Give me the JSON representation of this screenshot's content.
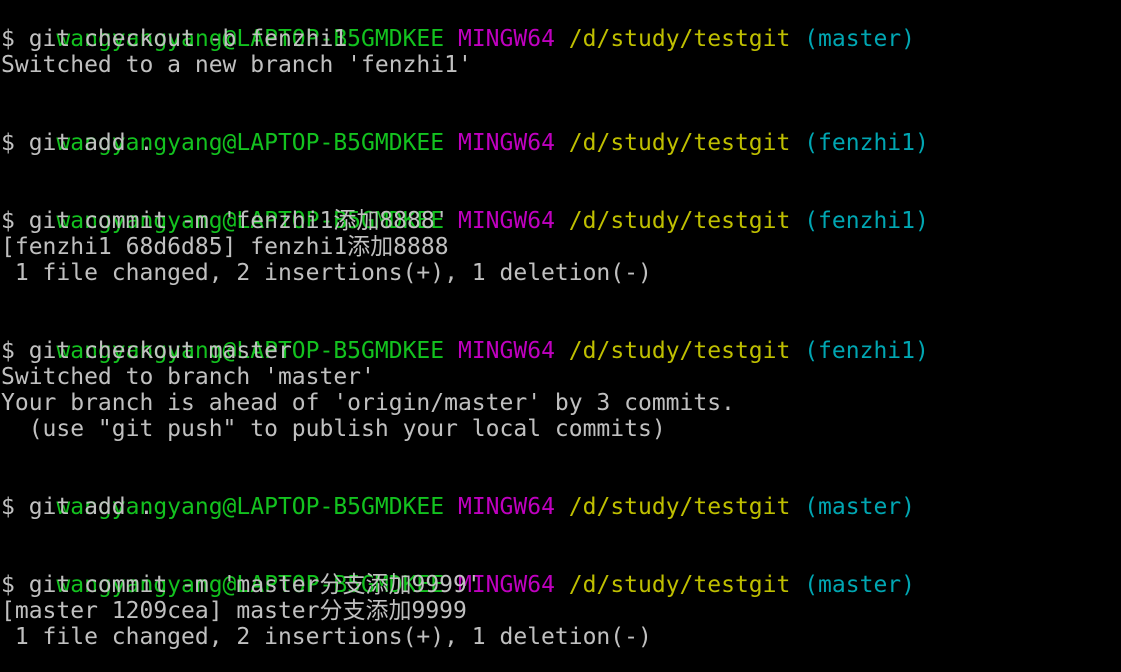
{
  "colors": {
    "background": "#000000",
    "text": "#c0c0c0",
    "user_host": "#13c21f",
    "shell": "#bf00bf",
    "path": "#bfbf00",
    "branch": "#00a6b2"
  },
  "blocks": [
    {
      "prompt": {
        "user": "wangyangyang@LAPTOP-B5GMDKEE",
        "shell": "MINGW64",
        "path": "/d/study/testgit",
        "branch": "(master)"
      },
      "command": "$ git checkout -b fenzhi1",
      "output": [
        "Switched to a new branch 'fenzhi1'"
      ]
    },
    {
      "prompt": {
        "user": "wangyangyang@LAPTOP-B5GMDKEE",
        "shell": "MINGW64",
        "path": "/d/study/testgit",
        "branch": "(fenzhi1)"
      },
      "command": "$ git add .",
      "output": []
    },
    {
      "prompt": {
        "user": "wangyangyang@LAPTOP-B5GMDKEE",
        "shell": "MINGW64",
        "path": "/d/study/testgit",
        "branch": "(fenzhi1)"
      },
      "command": "$ git commit -m 'fenzhi1添加8888'",
      "output": [
        "[fenzhi1 68d6d85] fenzhi1添加8888",
        " 1 file changed, 2 insertions(+), 1 deletion(-)"
      ]
    },
    {
      "prompt": {
        "user": "wangyangyang@LAPTOP-B5GMDKEE",
        "shell": "MINGW64",
        "path": "/d/study/testgit",
        "branch": "(fenzhi1)"
      },
      "command": "$ git checkout master",
      "output": [
        "Switched to branch 'master'",
        "Your branch is ahead of 'origin/master' by 3 commits.",
        "  (use \"git push\" to publish your local commits)"
      ]
    },
    {
      "prompt": {
        "user": "wangyangyang@LAPTOP-B5GMDKEE",
        "shell": "MINGW64",
        "path": "/d/study/testgit",
        "branch": "(master)"
      },
      "command": "$ git add .",
      "output": []
    },
    {
      "prompt": {
        "user": "wangyangyang@LAPTOP-B5GMDKEE",
        "shell": "MINGW64",
        "path": "/d/study/testgit",
        "branch": "(master)"
      },
      "command": "$ git commit -m 'master分支添加9999'",
      "output": [
        "[master 1209cea] master分支添加9999",
        " 1 file changed, 2 insertions(+), 1 deletion(-)"
      ]
    }
  ]
}
